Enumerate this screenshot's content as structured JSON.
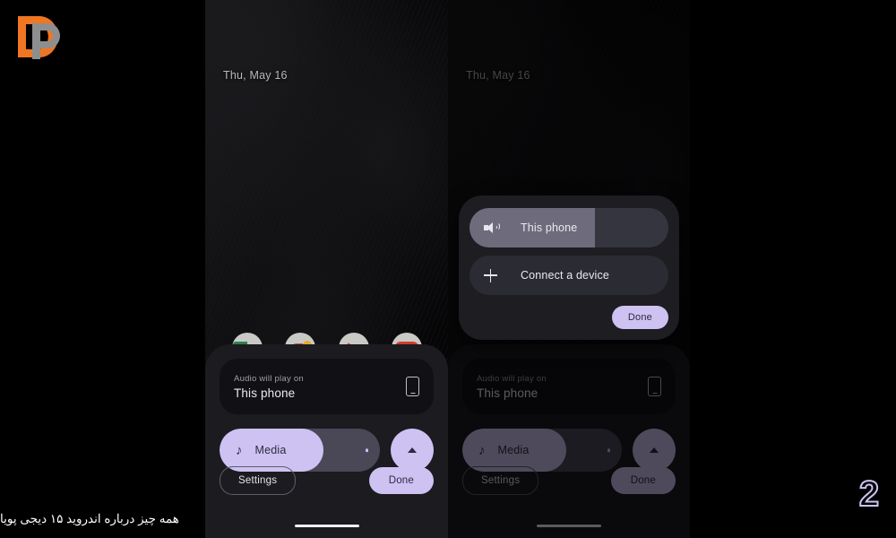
{
  "brand": {
    "logo_name": "digipouya-logo",
    "logo_colors": {
      "primary": "#ef7622",
      "secondary": "#8e8e8e"
    }
  },
  "caption": {
    "text": "همه چیز درباره اندروید ۱۵ دیجی پویا"
  },
  "page_number": {
    "value": "2",
    "color": "#cdc2f2"
  },
  "accent": {
    "purple": "#cdc2f2",
    "on_purple": "#2d2b40",
    "panel": "#1b1b20"
  },
  "phones": [
    {
      "id": "left",
      "status_date": "Thu, May 16",
      "panel": {
        "card": {
          "subtitle": "Audio will play on",
          "title": "This phone",
          "device_icon": "phone-icon"
        },
        "slider": {
          "label": "Media",
          "icon": "music-note-icon",
          "fill_percent": 65
        },
        "expander_icon": "caret-up-icon",
        "settings_label": "Settings",
        "done_label": "Done"
      },
      "dimmed": false,
      "dialog": null
    },
    {
      "id": "right",
      "status_date": "Thu, May 16",
      "panel": {
        "card": {
          "subtitle": "Audio will play on",
          "title": "This phone",
          "device_icon": "phone-icon"
        },
        "slider": {
          "label": "Media",
          "icon": "music-note-icon",
          "fill_percent": 65
        },
        "expander_icon": "caret-up-icon",
        "settings_label": "Settings",
        "done_label": "Done"
      },
      "dimmed": true,
      "dialog": {
        "rows": [
          {
            "label": "This phone",
            "icon": "speaker-icon",
            "fill_percent": 63,
            "active": true
          },
          {
            "label": "Connect a device",
            "icon": "plus-icon",
            "fill_percent": 0,
            "active": false
          }
        ],
        "done_label": "Done"
      }
    }
  ]
}
